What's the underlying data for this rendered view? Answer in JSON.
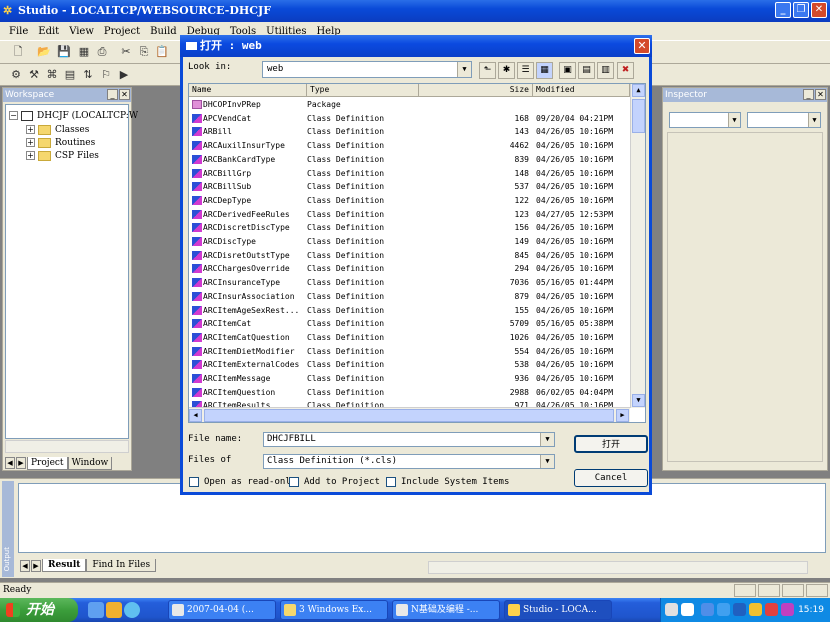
{
  "app": {
    "title": "Studio - LOCALTCP/WEBSOURCE-DHCJF",
    "menu": [
      "File",
      "Edit",
      "View",
      "Project",
      "Build",
      "Debug",
      "Tools",
      "Utilities",
      "Help"
    ]
  },
  "workspace": {
    "title": "Workspace",
    "tree": {
      "root": "DHCJF  (LOCALTCP:W",
      "children": [
        "Classes",
        "Routines",
        "CSP Files"
      ]
    },
    "tabs": [
      "Project",
      "Window"
    ]
  },
  "inspector": {
    "title": "Inspector"
  },
  "output": {
    "side_label": "Output",
    "tabs": [
      "Result",
      "Find In Files"
    ]
  },
  "status": {
    "text": "Ready"
  },
  "dialog": {
    "title": "打开 : web",
    "look_in_label": "Look in:",
    "look_in_value": "web",
    "columns": {
      "name": "Name",
      "type": "Type",
      "size": "Size",
      "modified": "Modified"
    },
    "files": [
      {
        "name": "DHCOPInvPRep",
        "type": "Package",
        "size": "",
        "modified": "",
        "kind": "package"
      },
      {
        "name": "APCVendCat",
        "type": "Class Definition",
        "size": "168",
        "modified": "09/20/04 04:21PM",
        "kind": "class"
      },
      {
        "name": "ARBill",
        "type": "Class Definition",
        "size": "143",
        "modified": "04/26/05 10:16PM",
        "kind": "class"
      },
      {
        "name": "ARCAuxilInsurType",
        "type": "Class Definition",
        "size": "4462",
        "modified": "04/26/05 10:16PM",
        "kind": "class"
      },
      {
        "name": "ARCBankCardType",
        "type": "Class Definition",
        "size": "839",
        "modified": "04/26/05 10:16PM",
        "kind": "class"
      },
      {
        "name": "ARCBillGrp",
        "type": "Class Definition",
        "size": "148",
        "modified": "04/26/05 10:16PM",
        "kind": "class"
      },
      {
        "name": "ARCBillSub",
        "type": "Class Definition",
        "size": "537",
        "modified": "04/26/05 10:16PM",
        "kind": "class"
      },
      {
        "name": "ARCDepType",
        "type": "Class Definition",
        "size": "122",
        "modified": "04/26/05 10:16PM",
        "kind": "class"
      },
      {
        "name": "ARCDerivedFeeRules",
        "type": "Class Definition",
        "size": "123",
        "modified": "04/27/05 12:53PM",
        "kind": "class"
      },
      {
        "name": "ARCDiscretDiscType",
        "type": "Class Definition",
        "size": "156",
        "modified": "04/26/05 10:16PM",
        "kind": "class"
      },
      {
        "name": "ARCDiscType",
        "type": "Class Definition",
        "size": "149",
        "modified": "04/26/05 10:16PM",
        "kind": "class"
      },
      {
        "name": "ARCDisretOutstType",
        "type": "Class Definition",
        "size": "845",
        "modified": "04/26/05 10:16PM",
        "kind": "class"
      },
      {
        "name": "ARCChargesOverride",
        "type": "Class Definition",
        "size": "294",
        "modified": "04/26/05 10:16PM",
        "kind": "class"
      },
      {
        "name": "ARCInsuranceType",
        "type": "Class Definition",
        "size": "7036",
        "modified": "05/16/05 01:44PM",
        "kind": "class"
      },
      {
        "name": "ARCInsurAssociation",
        "type": "Class Definition",
        "size": "879",
        "modified": "04/26/05 10:16PM",
        "kind": "class"
      },
      {
        "name": "ARCItemAgeSexRest...",
        "type": "Class Definition",
        "size": "155",
        "modified": "04/26/05 10:16PM",
        "kind": "class"
      },
      {
        "name": "ARCItemCat",
        "type": "Class Definition",
        "size": "5709",
        "modified": "05/16/05 05:38PM",
        "kind": "class"
      },
      {
        "name": "ARCItemCatQuestion",
        "type": "Class Definition",
        "size": "1026",
        "modified": "04/26/05 10:16PM",
        "kind": "class"
      },
      {
        "name": "ARCItemDietModifier",
        "type": "Class Definition",
        "size": "554",
        "modified": "04/26/05 10:16PM",
        "kind": "class"
      },
      {
        "name": "ARCItemExternalCodes",
        "type": "Class Definition",
        "size": "538",
        "modified": "04/26/05 10:16PM",
        "kind": "class"
      },
      {
        "name": "ARCItemMessage",
        "type": "Class Definition",
        "size": "936",
        "modified": "04/26/05 10:16PM",
        "kind": "class"
      },
      {
        "name": "ARCItemQuestion",
        "type": "Class Definition",
        "size": "2988",
        "modified": "06/02/05 04:04PM",
        "kind": "class"
      },
      {
        "name": "ARCItemResults",
        "type": "Class Definition",
        "size": "971",
        "modified": "04/26/05 10:16PM",
        "kind": "class"
      }
    ],
    "file_name_label": "File name:",
    "file_name_value": "DHCJFBILL",
    "files_of_label": "Files of",
    "files_of_value": "Class Definition (*.cls)",
    "open_button": "打开",
    "cancel_button": "Cancel",
    "checks": [
      "Open as read-only",
      "Add to Project",
      "Include System Items"
    ]
  },
  "taskbar": {
    "start": "开始",
    "tasks": [
      {
        "label": "2007-04-04 (...",
        "active": false
      },
      {
        "label": "3 Windows Ex...",
        "active": false
      },
      {
        "label": "N基础及编程 -...",
        "active": false
      },
      {
        "label": "Studio - LOCA...",
        "active": true
      }
    ],
    "clock": "15:19"
  }
}
